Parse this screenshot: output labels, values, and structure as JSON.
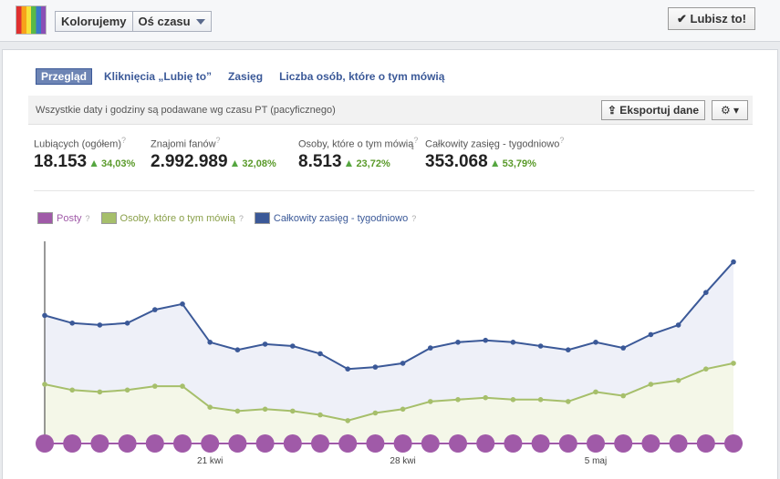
{
  "header": {
    "page_name": "Kolorujemy",
    "view_label": "Oś czasu",
    "like_button": "✔ Lubisz to!"
  },
  "tabs": [
    "Przegląd",
    "Kliknięcia „Lubię to”",
    "Zasięg",
    "Liczba osób, które o tym mówią"
  ],
  "infobar": {
    "text": "Wszystkie daty i godziny są podawane wg czasu PT (pacyficznego)",
    "export": "⇪ Eksportuj dane",
    "gear": "⚙ ▾"
  },
  "stats": [
    {
      "label": "Lubiących (ogółem)",
      "value": "18.153",
      "change": "34,03%"
    },
    {
      "label": "Znajomi fanów",
      "value": "2.992.989",
      "change": "32,08%"
    },
    {
      "label": "Osoby, które o tym mówią",
      "value": "8.513",
      "change": "23,72%"
    },
    {
      "label": "Całkowity zasięg - tygodniowo",
      "value": "353.068",
      "change": "53,79%"
    }
  ],
  "legend": [
    {
      "label": "Posty",
      "color": "#a05aa8"
    },
    {
      "label": "Osoby, które o tym mówią",
      "color": "#a6bf6b"
    },
    {
      "label": "Całkowity zasięg - tygodniowo",
      "color": "#3b5998"
    }
  ],
  "chart_data": {
    "type": "line",
    "x_tick_labels": [
      "21 kwi",
      "28 kwi",
      "5 maj"
    ],
    "series": [
      {
        "name": "Całkowity zasięg - tygodniowo",
        "color": "#3b5998",
        "values": [
          0.66,
          0.62,
          0.61,
          0.62,
          0.69,
          0.72,
          0.52,
          0.48,
          0.51,
          0.5,
          0.46,
          0.38,
          0.39,
          0.41,
          0.49,
          0.52,
          0.53,
          0.52,
          0.5,
          0.48,
          0.52,
          0.49,
          0.56,
          0.61,
          0.78,
          0.94
        ]
      },
      {
        "name": "Osoby, które o tym mówią",
        "color": "#a6bf6b",
        "values": [
          0.3,
          0.27,
          0.26,
          0.27,
          0.29,
          0.29,
          0.18,
          0.16,
          0.17,
          0.16,
          0.14,
          0.11,
          0.15,
          0.17,
          0.21,
          0.22,
          0.23,
          0.22,
          0.22,
          0.21,
          0.26,
          0.24,
          0.3,
          0.32,
          0.38,
          0.41
        ]
      },
      {
        "name": "Posty",
        "color": "#a05aa8",
        "values": [
          1,
          1,
          1,
          1,
          1,
          1,
          1,
          1,
          1,
          1,
          1,
          1,
          1,
          1,
          1,
          1,
          1,
          1,
          1,
          1,
          1,
          1,
          1,
          1,
          1,
          1
        ]
      }
    ]
  }
}
